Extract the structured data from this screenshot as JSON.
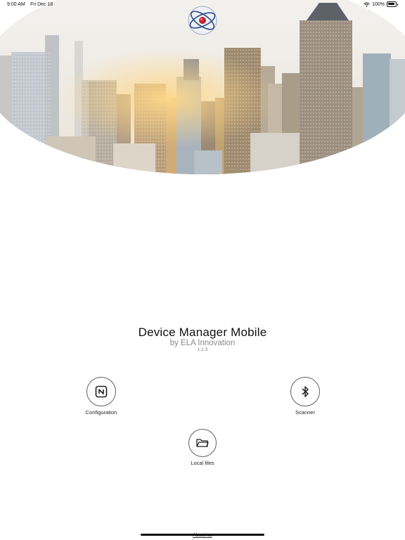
{
  "status_bar": {
    "time": "9:00 AM",
    "date": "Fri Dec 18",
    "battery": "100%",
    "wifi_icon": "wifi-icon",
    "battery_icon": "battery-icon"
  },
  "header": {
    "image": "city-skyline-image",
    "logo_icon": "ela-logo-icon"
  },
  "app": {
    "title": "Device Manager Mobile",
    "subtitle": "by ELA Innovation",
    "version": "1.2.3"
  },
  "actions": {
    "configuration": {
      "label": "Configuration",
      "icon": "nfc-icon"
    },
    "scanner": {
      "label": "Scanner",
      "icon": "bluetooth-icon"
    },
    "local_files": {
      "label": "Local files",
      "icon": "folder-icon"
    }
  },
  "footer": {
    "about_label": "About us"
  },
  "colors": {
    "circle_border": "#5b6070",
    "logo_red": "#c0262d",
    "logo_blue": "#2b4b8c"
  }
}
